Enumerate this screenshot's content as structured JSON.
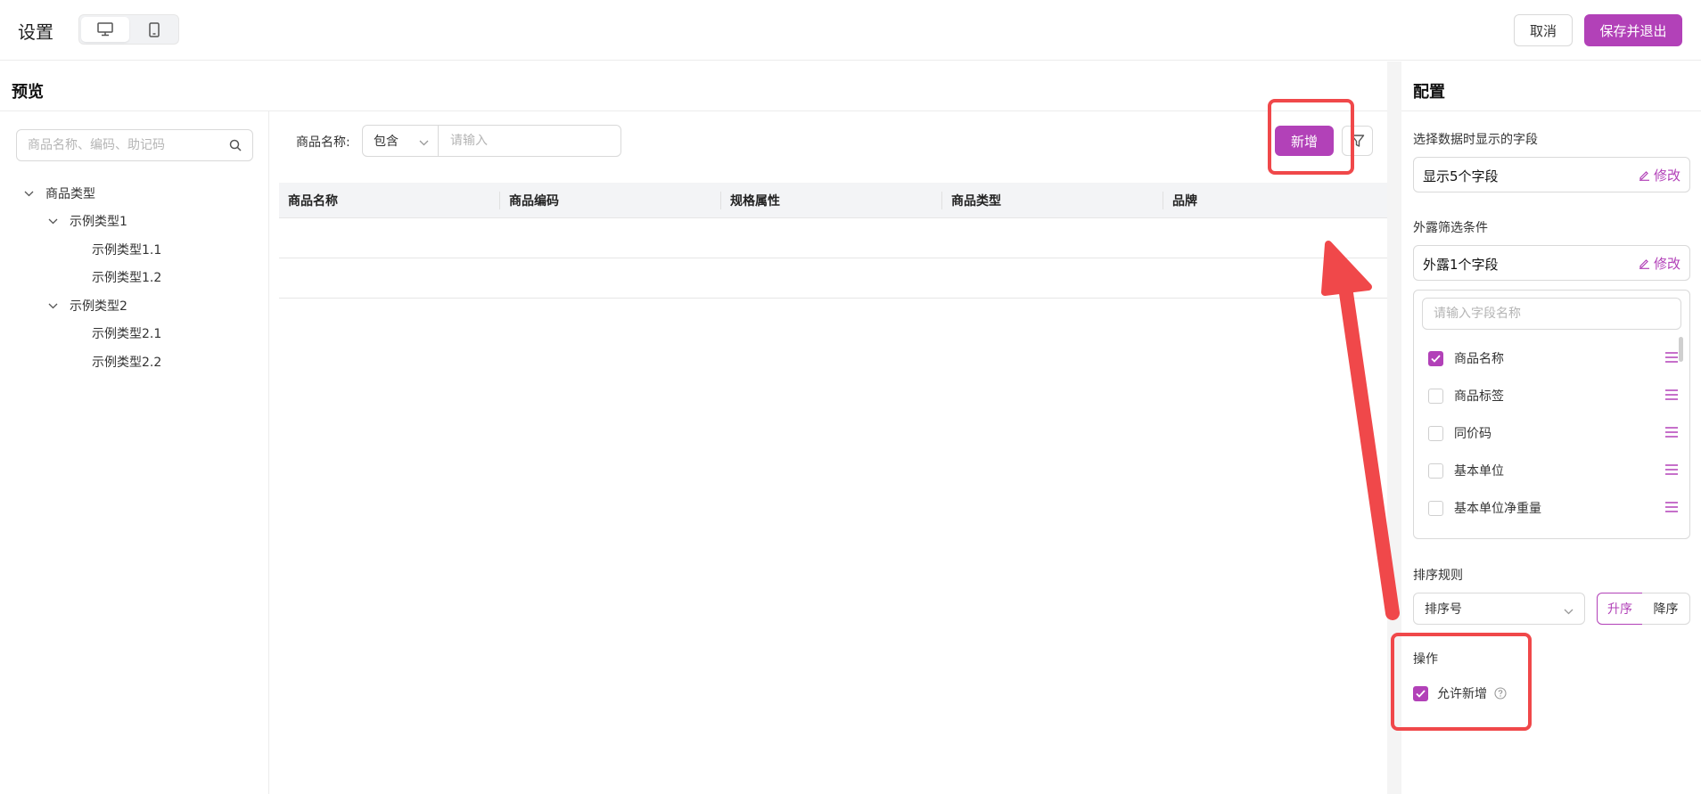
{
  "header": {
    "title": "设置",
    "cancel_label": "取消",
    "save_label": "保存并退出"
  },
  "preview": {
    "title": "预览",
    "search": {
      "placeholder": "商品名称、编码、助记码",
      "value": ""
    },
    "tree": [
      {
        "label": "商品类型",
        "level": 0,
        "expanded": true
      },
      {
        "label": "示例类型1",
        "level": 1,
        "expanded": true
      },
      {
        "label": "示例类型1.1",
        "level": 2
      },
      {
        "label": "示例类型1.2",
        "level": 2
      },
      {
        "label": "示例类型2",
        "level": 1,
        "expanded": true
      },
      {
        "label": "示例类型2.1",
        "level": 2
      },
      {
        "label": "示例类型2.2",
        "level": 2
      }
    ],
    "filter": {
      "label": "商品名称:",
      "operator": "包含",
      "placeholder": "请输入",
      "value": ""
    },
    "add_label": "新增",
    "table": {
      "columns": [
        "商品名称",
        "商品编码",
        "规格属性",
        "商品类型",
        "品牌"
      ],
      "rows": [
        [],
        []
      ]
    }
  },
  "config": {
    "title": "配置",
    "display_fields": {
      "label": "选择数据时显示的字段",
      "value": "显示5个字段",
      "edit_label": "修改"
    },
    "exposed_filters": {
      "label": "外露筛选条件",
      "value": "外露1个字段",
      "edit_label": "修改"
    },
    "field_search": {
      "placeholder": "请输入字段名称",
      "value": ""
    },
    "fields": [
      {
        "label": "商品名称",
        "checked": true
      },
      {
        "label": "商品标签",
        "checked": false
      },
      {
        "label": "同价码",
        "checked": false
      },
      {
        "label": "基本单位",
        "checked": false
      },
      {
        "label": "基本单位净重量",
        "checked": false
      }
    ],
    "sort": {
      "label": "排序规则",
      "field": "排序号",
      "asc_label": "升序",
      "desc_label": "降序",
      "selected": "asc"
    },
    "actions": {
      "label": "操作",
      "allow_add_label": "允许新增",
      "allow_add_checked": true
    }
  },
  "colors": {
    "accent": "#b241b8",
    "annotation": "#f0484a"
  }
}
